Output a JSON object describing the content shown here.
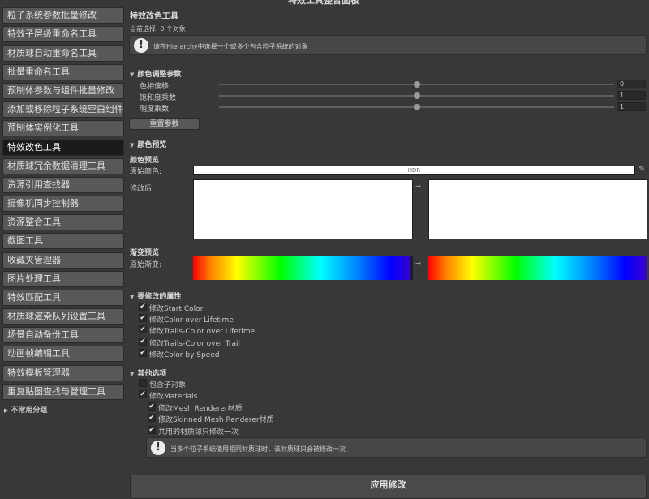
{
  "window": {
    "title": "特效工具整合面板"
  },
  "sidebar": {
    "items": [
      {
        "label": "粒子系统参数批量修改"
      },
      {
        "label": "特效子层级重命名工具"
      },
      {
        "label": "材质球自动重命名工具"
      },
      {
        "label": "批量重命名工具"
      },
      {
        "label": "预制体参数与组件批量修改"
      },
      {
        "label": "添加或移除粒子系统空白组件"
      },
      {
        "label": "预制体实例化工具"
      },
      {
        "label": "特效改色工具",
        "active": true
      },
      {
        "label": "材质球冗余数据清理工具"
      },
      {
        "label": "资源引用查找器"
      },
      {
        "label": "摄像机同步控制器"
      },
      {
        "label": "资源整合工具"
      },
      {
        "label": "截图工具"
      },
      {
        "label": "收藏夹管理器"
      },
      {
        "label": "图片处理工具"
      },
      {
        "label": "特效匹配工具"
      },
      {
        "label": "材质球渲染队列设置工具"
      },
      {
        "label": "场景自动备份工具"
      },
      {
        "label": "动画帧编辑工具"
      },
      {
        "label": "特效模板管理器"
      },
      {
        "label": "重复贴图查找与管理工具"
      }
    ],
    "group_label": "不常用分组"
  },
  "main": {
    "title": "特效改色工具",
    "selection_text": "当前选择: 0 个对象",
    "help_top": "请在Hierarchy中选择一个或多个包含粒子系统的对象",
    "color_params": {
      "header": "颜色调整参数",
      "hue_label": "色相偏移",
      "hue_value": "0",
      "hue_fraction": 0.5,
      "saturation_label": "饱和度乘数",
      "saturation_value": "1",
      "saturation_fraction": 0.5,
      "brightness_label": "明度乘数",
      "brightness_value": "1",
      "brightness_fraction": 0.5,
      "reset_label": "重置参数"
    },
    "color_preview": {
      "header": "颜色预览",
      "subheader": "颜色预览",
      "original_label": "原始颜色:",
      "hdr_label": "HDR",
      "modified_label": "修改后:",
      "arrow": "→",
      "gradient_header": "渐变预览",
      "gradient_label": "原始渐变:"
    },
    "properties": {
      "header": "要修改的属性",
      "items": [
        {
          "label": "修改Start Color",
          "checked": true
        },
        {
          "label": "修改Color over Lifetime",
          "checked": true
        },
        {
          "label": "修改Trails-Color over Lifetime",
          "checked": true
        },
        {
          "label": "修改Trails-Color over Trail",
          "checked": true
        },
        {
          "label": "修改Color by Speed",
          "checked": true
        }
      ]
    },
    "other": {
      "header": "其他选项",
      "include_children": {
        "label": "包含子对象",
        "checked": false
      },
      "modify_materials": {
        "label": "修改Materials",
        "checked": true
      },
      "sub_items": [
        {
          "label": "修改Mesh Renderer材质",
          "checked": true
        },
        {
          "label": "修改Skinned Mesh Renderer材质",
          "checked": true
        },
        {
          "label": "共用的材质球只修改一次",
          "checked": true
        }
      ],
      "help": "当多个粒子系统使用相同材质球时，该材质球只会被修改一次"
    },
    "apply_label": "应用修改"
  },
  "colors": {
    "background": "#383838",
    "button": "#585858",
    "active_button": "#1b1b1b"
  }
}
